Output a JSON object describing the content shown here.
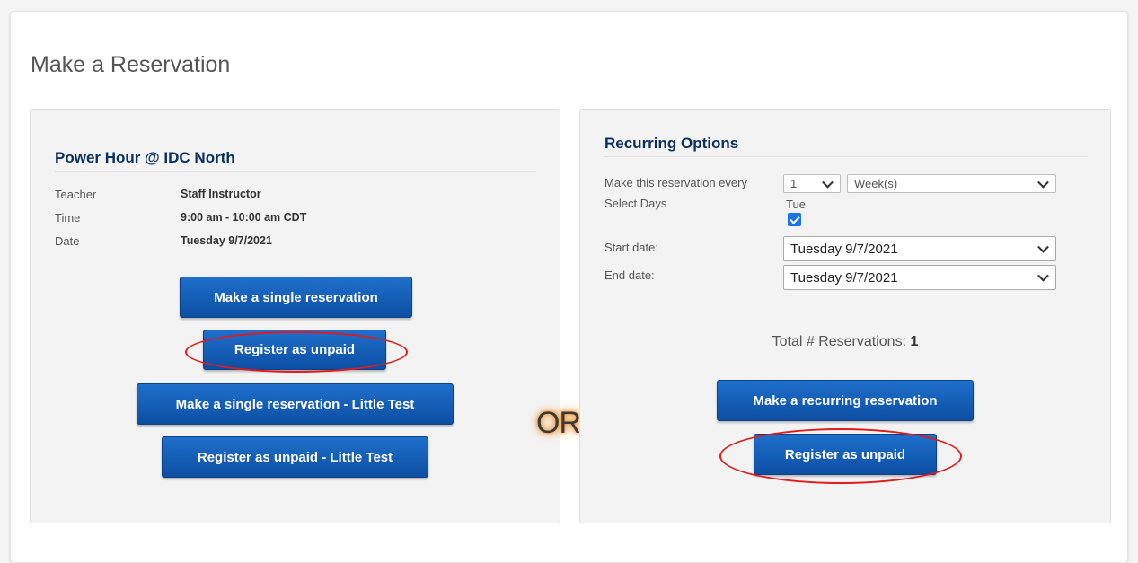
{
  "page": {
    "title": "Make a Reservation"
  },
  "class_info": {
    "name": "Power Hour @ IDC North",
    "details": [
      {
        "label": "Teacher",
        "value": "Staff Instructor"
      },
      {
        "label": "Time",
        "value": "9:00 am - 10:00 am  CDT"
      },
      {
        "label": "Date",
        "value": "Tuesday 9/7/2021"
      }
    ]
  },
  "left_buttons": {
    "single": "Make a single reservation",
    "unpaid": "Register as unpaid",
    "single_little": "Make a single reservation - Little Test",
    "unpaid_little": "Register as unpaid - Little Test"
  },
  "or_label": "OR",
  "recurring": {
    "title": "Recurring Options",
    "every_label": "Make this reservation every",
    "every_count": "1",
    "every_unit": "Week(s)",
    "select_days_label": "Select Days",
    "day": "Tue",
    "day_checked": true,
    "start_label": "Start date:",
    "start_value": "Tuesday 9/7/2021",
    "end_label": "End date:",
    "end_value": "Tuesday 9/7/2021",
    "total_label": "Total # Reservations:",
    "total_value": "1",
    "recurring_button": "Make a recurring reservation",
    "unpaid_button": "Register as unpaid"
  },
  "colors": {
    "button_blue": "#1563bf",
    "title_navy": "#0b2f5c",
    "highlight_red": "#e01b1b",
    "checkbox_blue": "#1a73e8"
  }
}
